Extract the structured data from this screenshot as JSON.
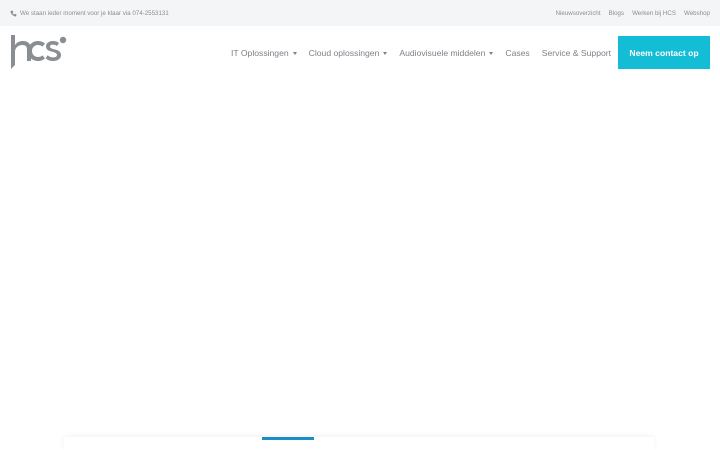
{
  "topbar": {
    "phone_text": "We staan ieder moment voor je klaar via 074-2553131",
    "phone_icon": "phone-icon",
    "links": [
      "Nieuwsoverzicht",
      "Blogs",
      "Werken bij HCS",
      "Webshop"
    ]
  },
  "logo": {
    "text": "hcs"
  },
  "nav": {
    "items": [
      {
        "label": "IT Oplossingen",
        "dropdown": true
      },
      {
        "label": "Cloud oplossingen",
        "dropdown": true
      },
      {
        "label": "Audiovisuele middelen",
        "dropdown": true
      },
      {
        "label": "Cases",
        "dropdown": false
      },
      {
        "label": "Service & Support",
        "dropdown": false
      }
    ]
  },
  "cta": {
    "label": "Neem contact op"
  },
  "colors": {
    "accent": "#14bdd6",
    "indicator": "#1a8fc4",
    "topbar_bg": "#f4f5f7"
  }
}
